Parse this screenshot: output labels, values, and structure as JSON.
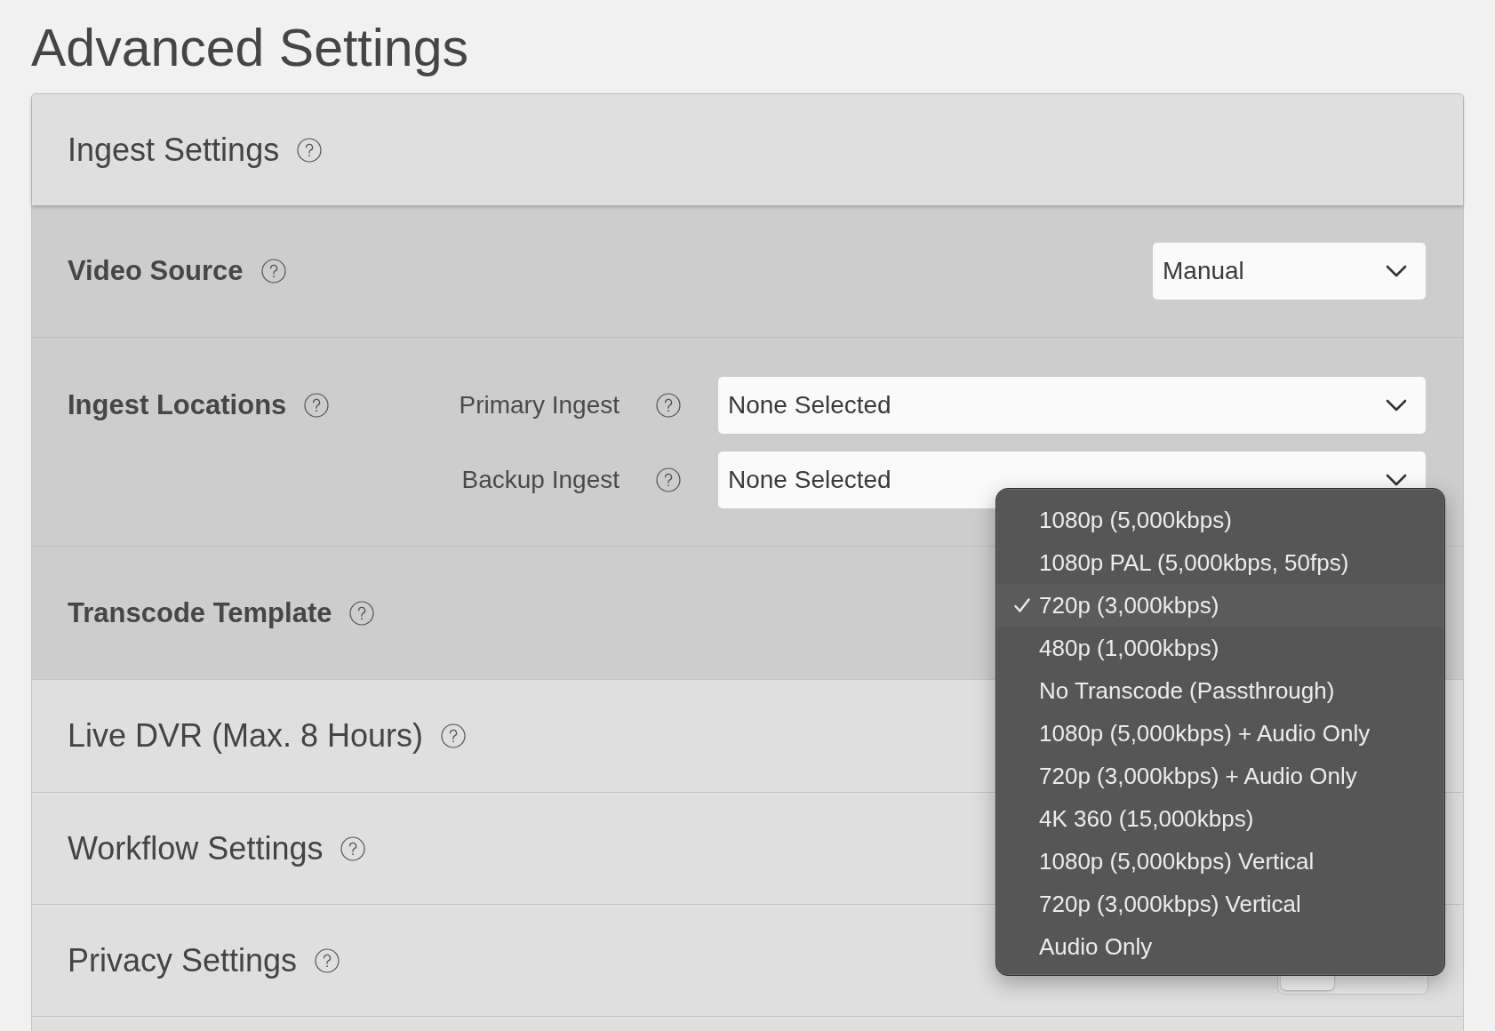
{
  "title": "Advanced Settings",
  "panel": {
    "sections": [
      {
        "kind": "header",
        "label": "Ingest Settings"
      },
      {
        "kind": "select",
        "label": "Video Source",
        "value": "Manual"
      },
      {
        "kind": "fields",
        "label": "Ingest Locations",
        "fields": [
          {
            "label": "Primary Ingest",
            "value": "None Selected"
          },
          {
            "label": "Backup Ingest",
            "value": "None Selected"
          }
        ]
      },
      {
        "kind": "menu_select",
        "label": "Transcode Template",
        "menu": {
          "options": [
            {
              "label": "1080p (5,000kbps)",
              "selected": false
            },
            {
              "label": "1080p PAL (5,000kbps, 50fps)",
              "selected": false
            },
            {
              "label": "720p (3,000kbps)",
              "selected": true
            },
            {
              "label": "480p (1,000kbps)",
              "selected": false
            },
            {
              "label": "No Transcode (Passthrough)",
              "selected": false
            },
            {
              "label": "1080p (5,000kbps) + Audio Only",
              "selected": false
            },
            {
              "label": "720p (3,000kbps) + Audio Only",
              "selected": false
            },
            {
              "label": "4K 360 (15,000kbps)",
              "selected": false
            },
            {
              "label": "1080p (5,000kbps) Vertical",
              "selected": false
            },
            {
              "label": "720p (3,000kbps) Vertical",
              "selected": false
            },
            {
              "label": "Audio Only",
              "selected": false
            }
          ]
        }
      },
      {
        "kind": "header",
        "label": "Live DVR (Max. 8 Hours)"
      },
      {
        "kind": "header",
        "label": "Workflow Settings"
      },
      {
        "kind": "header",
        "label": "Privacy Settings",
        "toggle": {
          "on": false
        }
      }
    ]
  }
}
